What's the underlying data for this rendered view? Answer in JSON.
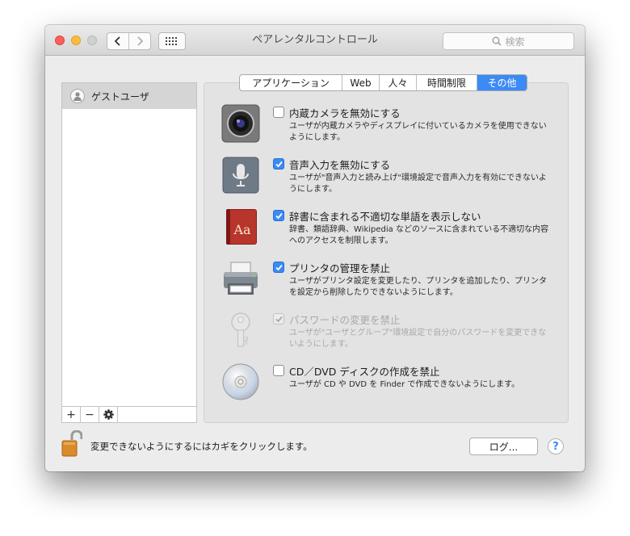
{
  "window": {
    "title": "ペアレンタルコントロール"
  },
  "search": {
    "placeholder": "検索",
    "icon": "magnifier-icon"
  },
  "users": [
    {
      "name": "ゲストユーザ"
    }
  ],
  "list_buttons": {
    "add": "+",
    "remove": "−"
  },
  "tabs": [
    {
      "label": "アプリケーション",
      "active": false
    },
    {
      "label": "Web",
      "active": false
    },
    {
      "label": "人々",
      "active": false
    },
    {
      "label": "時間制限",
      "active": false
    },
    {
      "label": "その他",
      "active": true
    }
  ],
  "options": [
    {
      "title": "内蔵カメラを無効にする",
      "desc": "ユーザが内蔵カメラやディスプレイに付いているカメラを使用できないようにします。",
      "checked": false,
      "disabled": false,
      "icon": "camera-icon"
    },
    {
      "title": "音声入力を無効にする",
      "desc": "ユーザが\"音声入力と読み上げ\"環境設定で音声入力を有効にできないようにします。",
      "checked": true,
      "disabled": false,
      "icon": "microphone-icon"
    },
    {
      "title": "辞書に含まれる不適切な単語を表示しない",
      "desc": "辞書、類語辞典、Wikipedia などのソースに含まれている不適切な内容へのアクセスを制限します。",
      "checked": true,
      "disabled": false,
      "icon": "dictionary-icon"
    },
    {
      "title": "プリンタの管理を禁止",
      "desc": "ユーザがプリンタ設定を変更したり、プリンタを追加したり、プリンタを設定から削除したりできないようにします。",
      "checked": true,
      "disabled": false,
      "icon": "printer-icon"
    },
    {
      "title": "パスワードの変更を禁止",
      "desc": "ユーザが\"ユーザとグループ\"環境設定で自分のパスワードを変更できないようにします。",
      "checked": true,
      "disabled": true,
      "icon": "key-icon"
    },
    {
      "title": "CD／DVD ディスクの作成を禁止",
      "desc": "ユーザが CD や DVD を Finder で作成できないようにします。",
      "checked": false,
      "disabled": false,
      "icon": "disc-icon"
    }
  ],
  "footer": {
    "lock_text": "変更できないようにするにはカギをクリックします。",
    "logs_button": "ログ...",
    "help_button": "?"
  },
  "colors": {
    "accent": "#3b8af5",
    "window_bg": "#ececec"
  }
}
